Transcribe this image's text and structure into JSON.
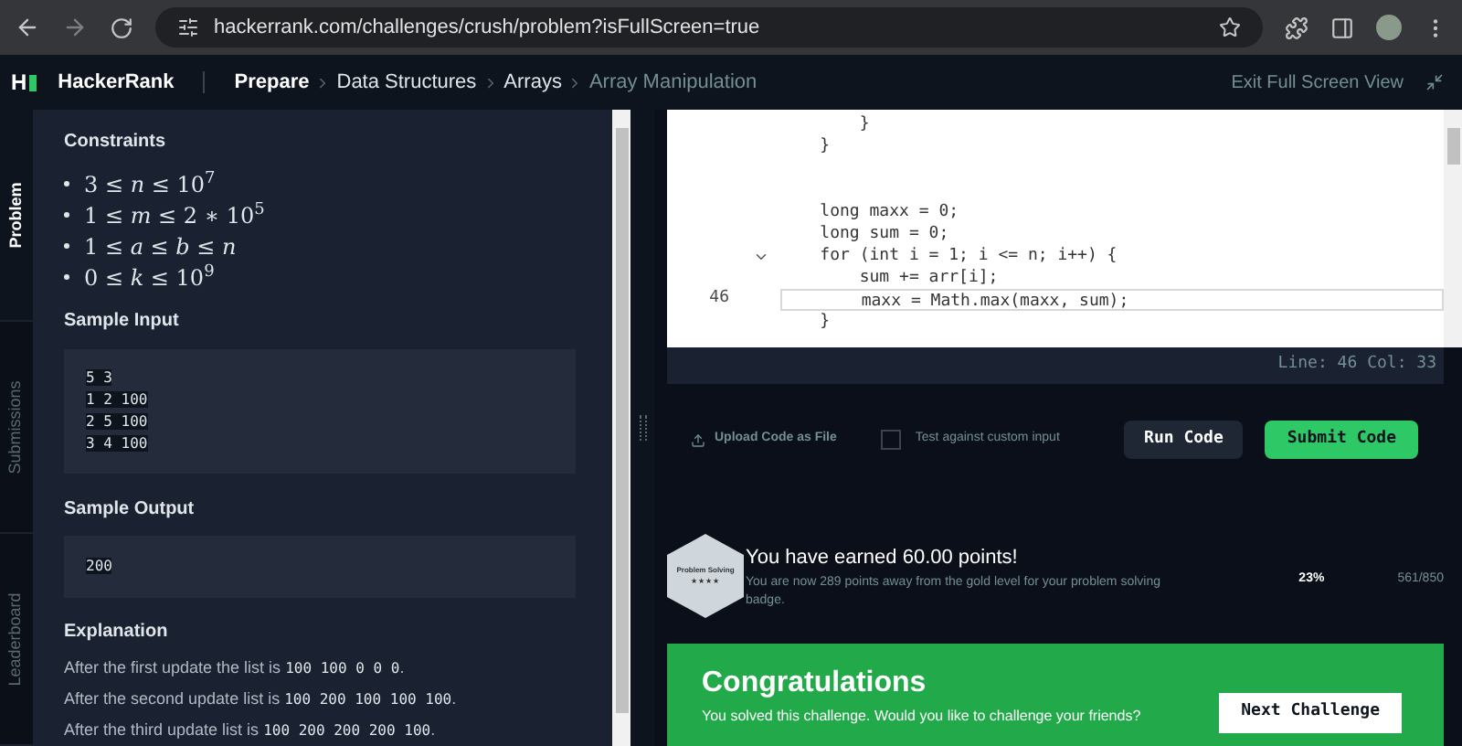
{
  "browser": {
    "url": "hackerrank.com/challenges/crush/problem?isFullScreen=true"
  },
  "header": {
    "logo": "H",
    "brand": "HackerRank",
    "breadcrumbs": [
      {
        "label": "Prepare",
        "current": false
      },
      {
        "label": "Data Structures",
        "current": false
      },
      {
        "label": "Arrays",
        "current": false
      },
      {
        "label": "Array Manipulation",
        "current": true
      }
    ],
    "exit": "Exit Full Screen View"
  },
  "side_tabs": [
    {
      "label": "Problem",
      "selected": true
    },
    {
      "label": "Submissions",
      "selected": false
    },
    {
      "label": "Leaderboard",
      "selected": false
    }
  ],
  "problem": {
    "constraints_title": "Constraints",
    "constraints": [
      "3 ≤ *n* ≤ 10$^{7}$",
      "1 ≤ *m* ≤ 2 ∗ 10$^{5}$",
      "1 ≤ *a* ≤ *b* ≤ *n*",
      "0 ≤ *k* ≤ 10$^{9}$"
    ],
    "sample_input_title": "Sample Input",
    "sample_input": [
      "5 3",
      "1 2 100",
      "2 5 100",
      "3 4 100"
    ],
    "sample_output_title": "Sample Output",
    "sample_output": [
      "200"
    ],
    "explanation_title": "Explanation",
    "explanation": [
      {
        "text": "After the first update the list is ",
        "code": "100 100 0 0 0",
        "end": "."
      },
      {
        "text": "After the second update list is ",
        "code": "100 200 100 100 100",
        "end": "."
      },
      {
        "text": "After the third update list is ",
        "code": "100 200 200 200 100",
        "end": "."
      }
    ]
  },
  "editor": {
    "lines": [
      {
        "code": "        }",
        "current": false,
        "fold": false
      },
      {
        "code": "    }",
        "current": false,
        "fold": false
      },
      {
        "current": false,
        "fold": false
      },
      {
        "current": false,
        "fold": false
      },
      {
        "code": "    long maxx = 0;",
        "current": false,
        "fold": false
      },
      {
        "code": "    long sum = 0;",
        "current": false,
        "fold": false
      },
      {
        "code": "    for (int i = 1; i <= n; i++) {",
        "current": false,
        "fold": true
      },
      {
        "code": "        sum += arr[i];",
        "current": false,
        "fold": false
      },
      {
        "number": "46",
        "code": "        maxx = Math.max(maxx, sum);",
        "current": true,
        "fold": false
      },
      {
        "code": "    }",
        "current": false,
        "fold": false
      }
    ],
    "status": "Line: 46 Col: 33"
  },
  "actions": {
    "upload": "Upload Code as File",
    "custom_input": {
      "label": "Test against custom input",
      "checked": false
    },
    "run": "Run Code",
    "submit": "Submit Code"
  },
  "result": {
    "badge": "Problem Solving",
    "badge_stars": "★★★★",
    "title": "You have earned 60.00 points!",
    "message": "You are now 289 points away from the gold level for your problem solving badge.",
    "percent": "23%",
    "score": "561/850"
  },
  "congrats": {
    "title": "Congratulations",
    "message": "You solved this challenge. Would you like to challenge your friends?",
    "next": "Next Challenge"
  }
}
